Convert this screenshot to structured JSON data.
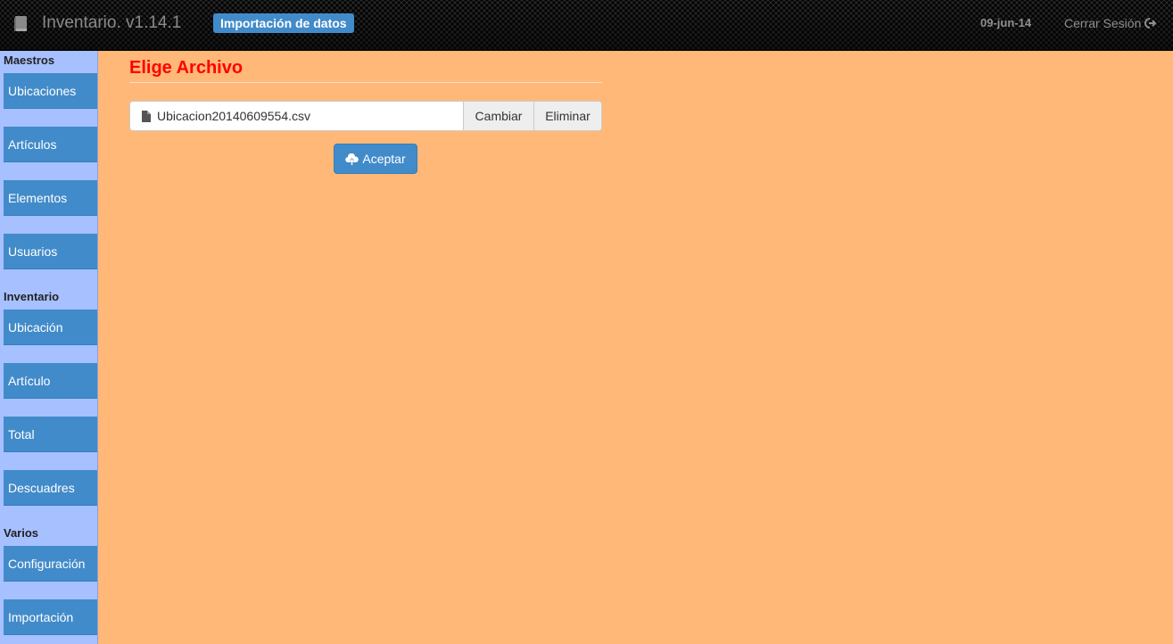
{
  "navbar": {
    "brand_icon": "book-icon",
    "title": "Inventario. v1.14.1",
    "page_badge": "Importación de datos",
    "date": "09-jun-14",
    "logout_label": "Cerrar Sesión",
    "logout_icon": "logout-icon"
  },
  "sidebar": {
    "sections": [
      {
        "title": "Maestros",
        "items": [
          "Ubicaciones",
          "Artículos",
          "Elementos",
          "Usuarios"
        ]
      },
      {
        "title": "Inventario",
        "items": [
          "Ubicación",
          "Artículo",
          "Total",
          "Descuadres"
        ]
      },
      {
        "title": "Varios",
        "items": [
          "Configuración",
          "Importación"
        ]
      }
    ]
  },
  "main": {
    "title": "Elige Archivo",
    "file_input": {
      "file_icon": "file-icon",
      "filename": "Ubicacion20140609554.csv",
      "change_label": "Cambiar",
      "remove_label": "Eliminar"
    },
    "accept_button": {
      "icon": "cloud-upload-icon",
      "label": "Aceptar"
    }
  },
  "colors": {
    "accent": "#428bca",
    "page_background": "#ffb877",
    "sidebar_background": "#a7c0ff",
    "title": "#ff0000"
  }
}
